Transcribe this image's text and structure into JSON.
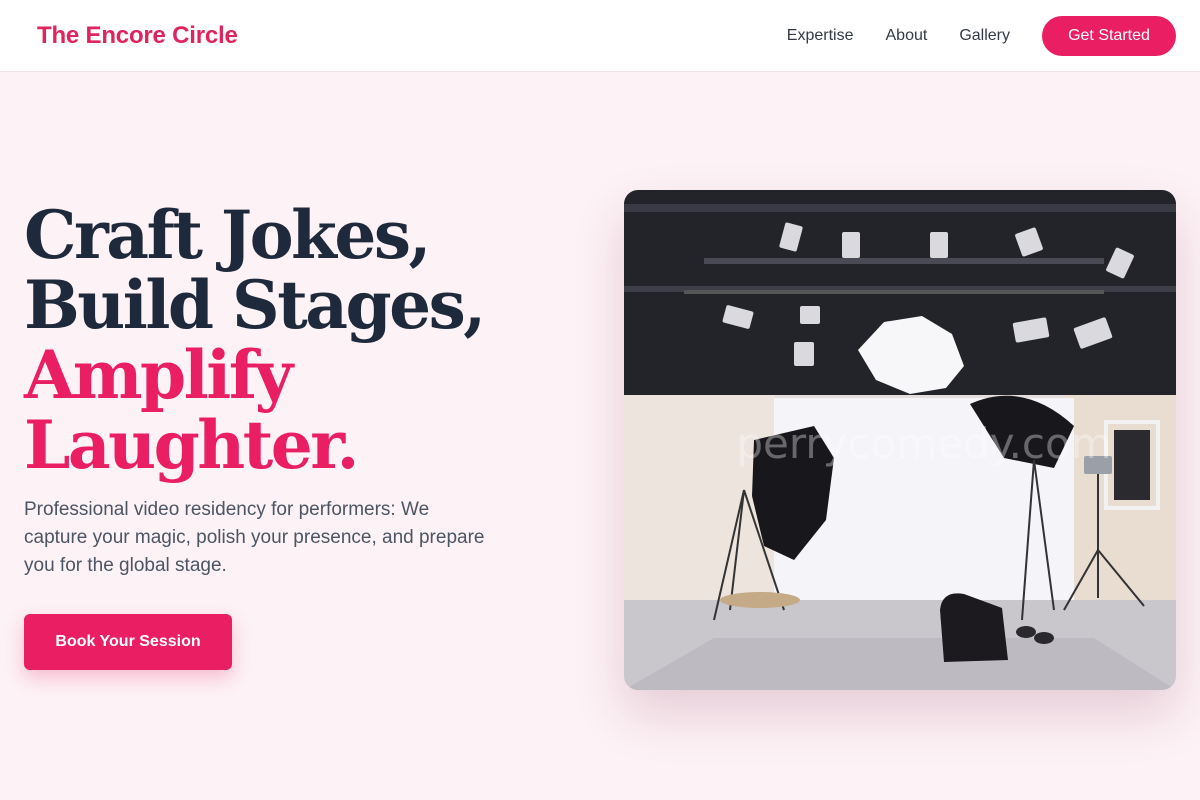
{
  "header": {
    "brand": "The Encore Circle",
    "nav": [
      {
        "label": "Expertise"
      },
      {
        "label": "About"
      },
      {
        "label": "Gallery"
      }
    ],
    "cta_label": "Get Started"
  },
  "hero": {
    "headline_lines": [
      "Craft Jokes,",
      "Build Stages,"
    ],
    "headline_accent_lines": [
      "Amplify",
      "Laughter."
    ],
    "subtext": "Professional video residency for performers: We capture your magic, polish your presence, and prepare you for the global stage.",
    "button_label": "Book Your Session",
    "image": {
      "icon": "photo-studio-image",
      "watermark": "perrycomedy.com"
    }
  },
  "colors": {
    "accent": "#e91e63",
    "background": "#fdf2f6",
    "heading": "#1e293b"
  }
}
